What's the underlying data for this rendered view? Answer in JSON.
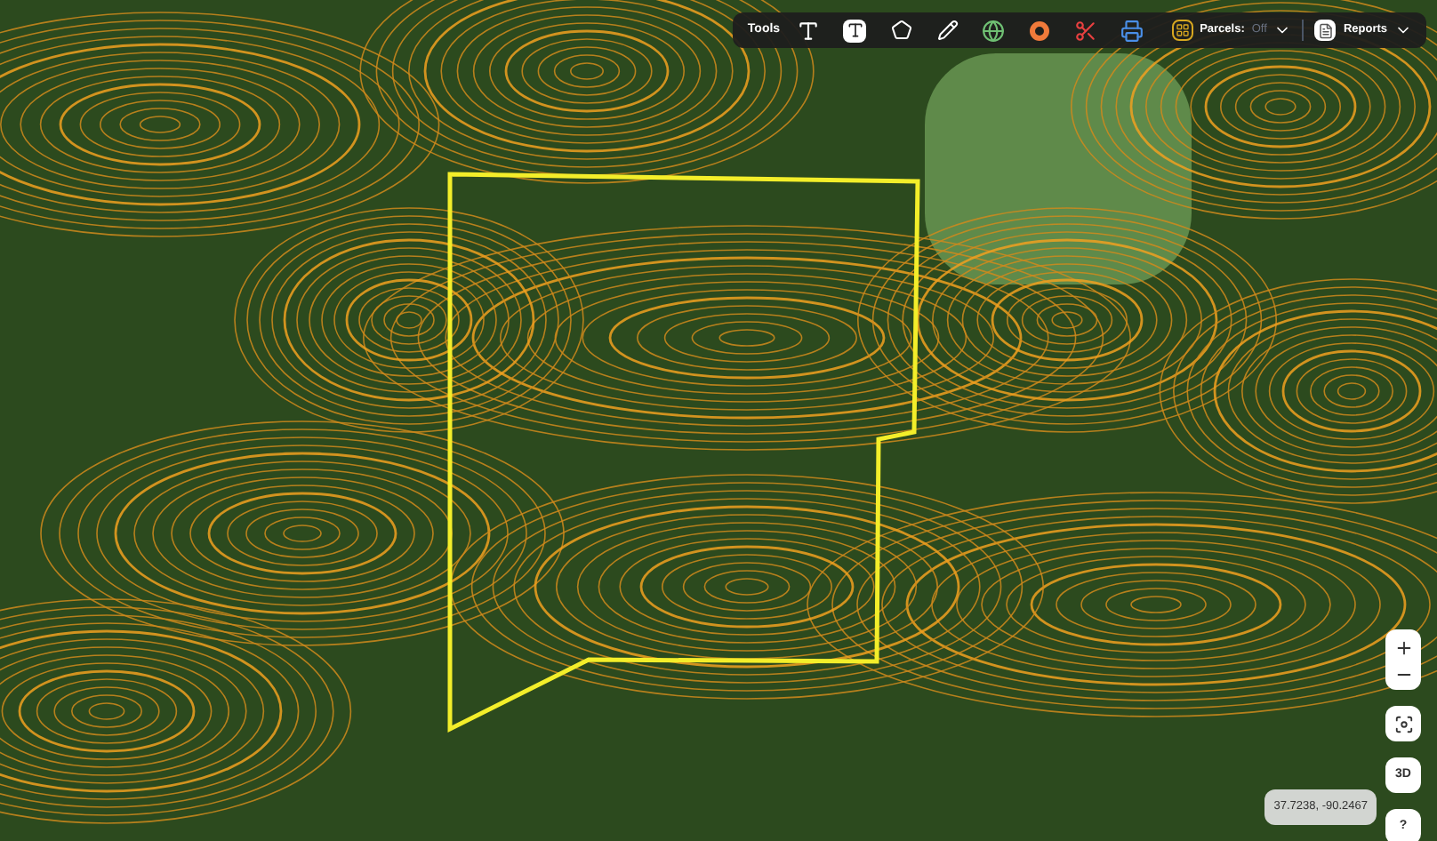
{
  "toolbar": {
    "label": "Tools",
    "parcels": {
      "label": "Parcels:",
      "value": "Off",
      "on": false
    },
    "reports": {
      "label": "Reports"
    }
  },
  "map_controls": {
    "three_d": "3D",
    "help": "?"
  },
  "coordinates": "37.7238, -90.2467"
}
